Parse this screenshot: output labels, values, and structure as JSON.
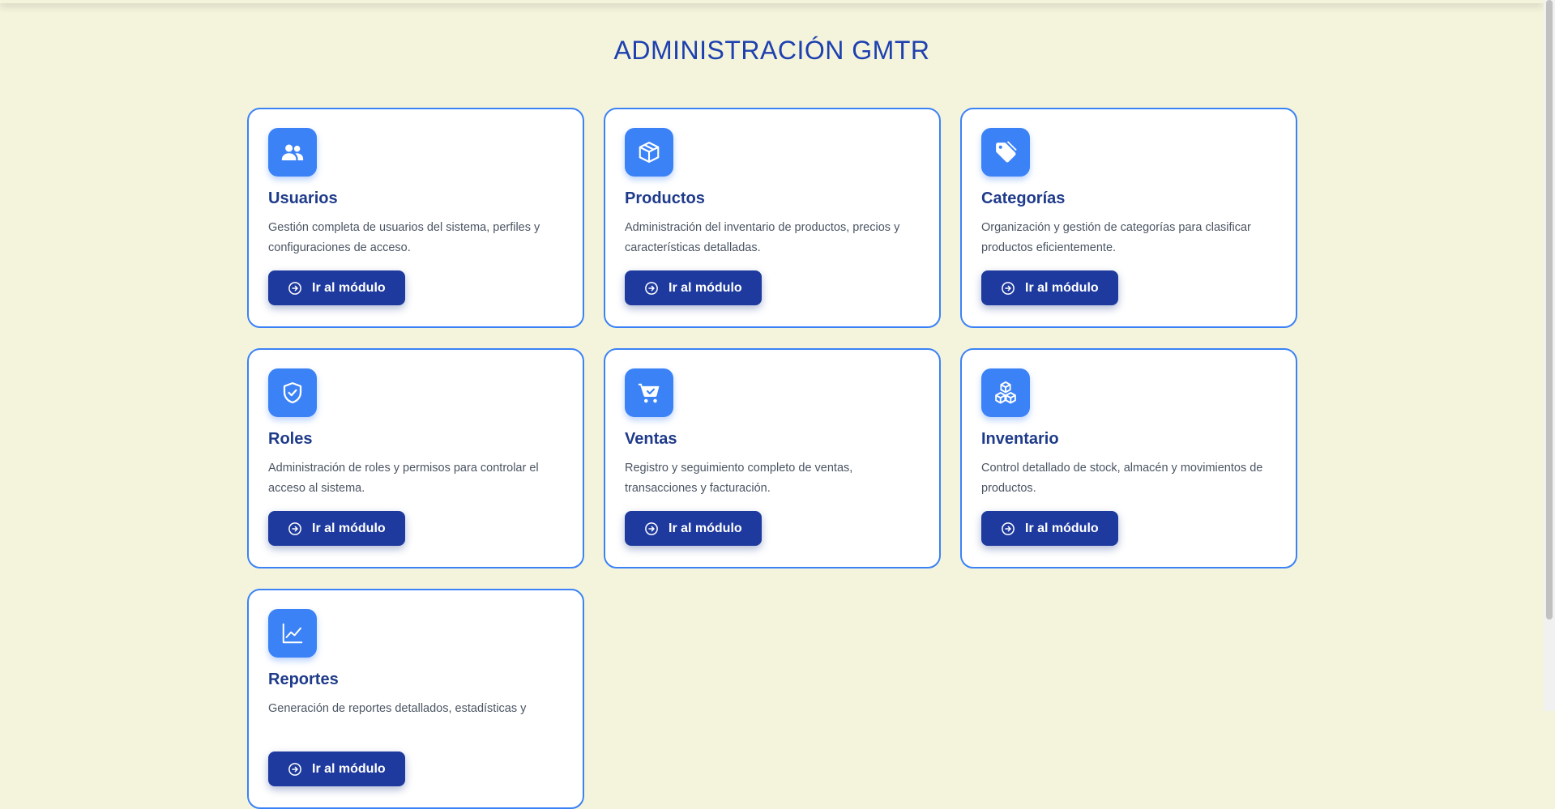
{
  "page": {
    "title": "ADMINISTRACIÓN GMTR"
  },
  "colors": {
    "background": "#f4f4dc",
    "accent": "#3b82f6",
    "title": "#1e40af",
    "button": "#1e3a9e"
  },
  "modules": [
    {
      "title": "Usuarios",
      "description": "Gestión completa de usuarios del sistema, perfiles y configuraciones de acceso.",
      "button": "Ir al módulo",
      "icon": "users-icon"
    },
    {
      "title": "Productos",
      "description": "Administración del inventario de productos, precios y características detalladas.",
      "button": "Ir al módulo",
      "icon": "box-icon"
    },
    {
      "title": "Categorías",
      "description": "Organización y gestión de categorías para clasificar productos eficientemente.",
      "button": "Ir al módulo",
      "icon": "tag-icon"
    },
    {
      "title": "Roles",
      "description": "Administración de roles y permisos para controlar el acceso al sistema.",
      "button": "Ir al módulo",
      "icon": "shield-check-icon"
    },
    {
      "title": "Ventas",
      "description": "Registro y seguimiento completo de ventas, transacciones y facturación.",
      "button": "Ir al módulo",
      "icon": "cart-check-icon"
    },
    {
      "title": "Inventario",
      "description": "Control detallado de stock, almacén y movimientos de productos.",
      "button": "Ir al módulo",
      "icon": "boxes-icon"
    },
    {
      "title": "Reportes",
      "description": "Generación de reportes detallados, estadísticas y",
      "button": "Ir al módulo",
      "icon": "chart-line-icon"
    }
  ]
}
